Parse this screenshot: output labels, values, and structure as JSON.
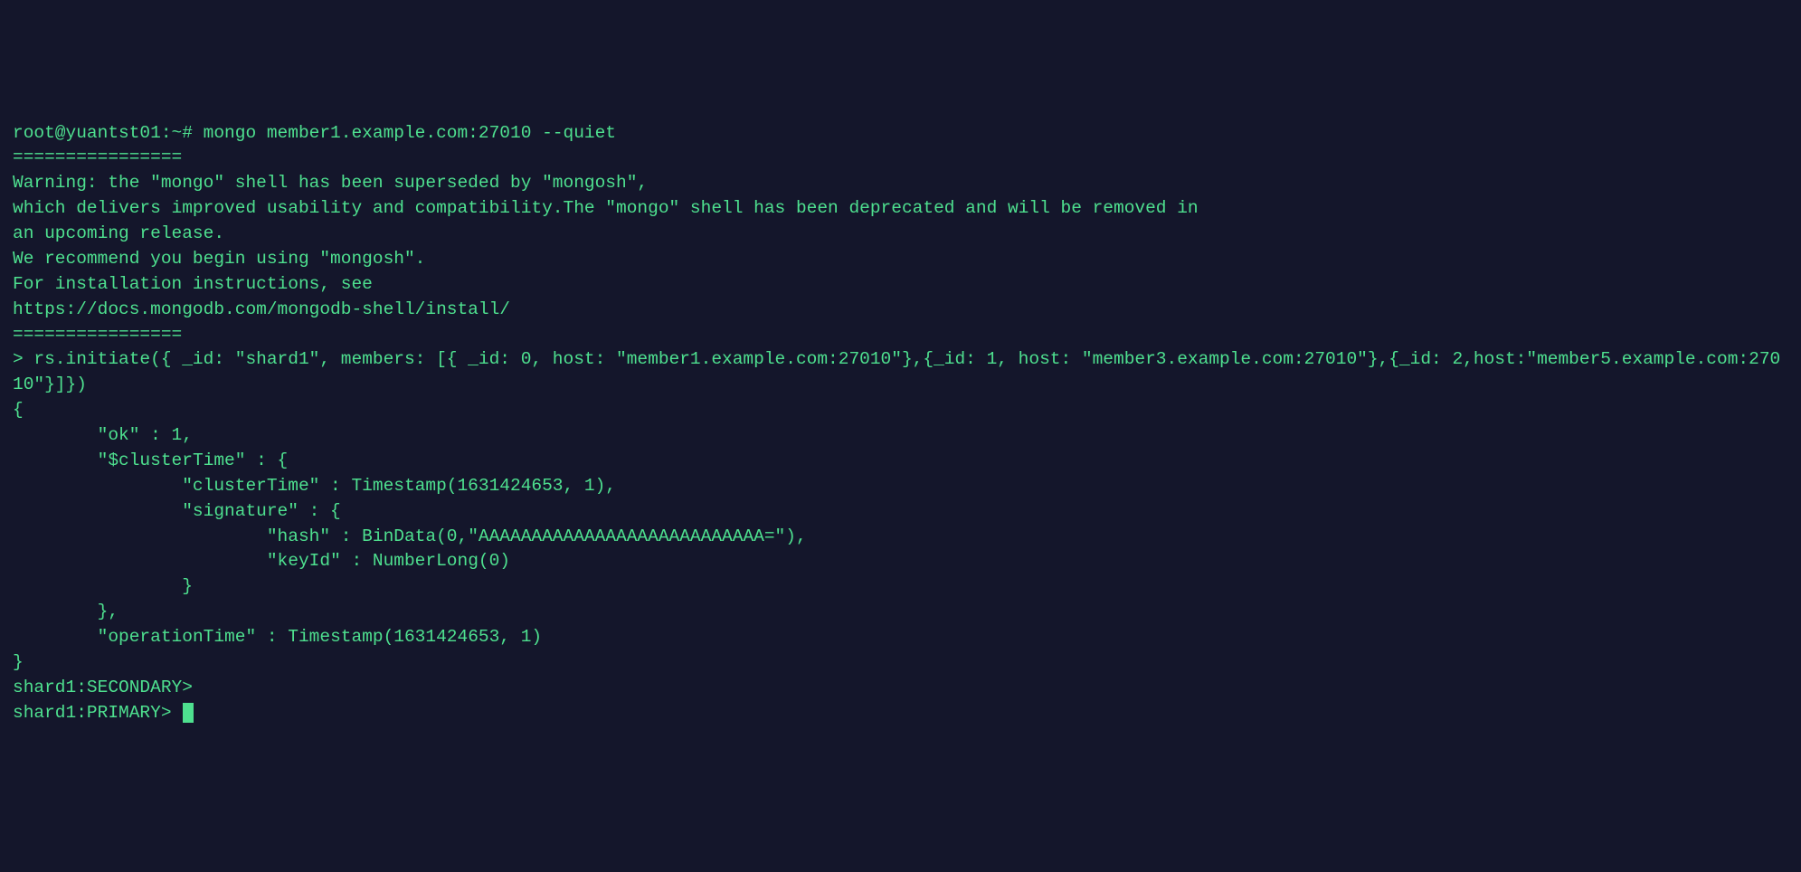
{
  "terminal": {
    "prompt_line": "root@yuantst01:~# mongo member1.example.com:27010 --quiet",
    "separator1": "================",
    "warning_line1": "Warning: the \"mongo\" shell has been superseded by \"mongosh\",",
    "warning_line2": "which delivers improved usability and compatibility.The \"mongo\" shell has been deprecated and will be removed in",
    "warning_line3": "an upcoming release.",
    "warning_line4": "We recommend you begin using \"mongosh\".",
    "warning_line5": "For installation instructions, see",
    "warning_line6": "https://docs.mongodb.com/mongodb-shell/install/",
    "separator2": "================",
    "cmd_line1": "> rs.initiate({ _id: \"shard1\", members: [{ _id: 0, host: \"member1.example.com:27010\"},{_id: 1, host: \"member3.example.com:27010\"},{_id: 2,host:\"member5.example.com:27010\"}]})",
    "resp_open": "{",
    "resp_ok": "        \"ok\" : 1,",
    "resp_cluster_open": "        \"$clusterTime\" : {",
    "resp_cluster_ts": "                \"clusterTime\" : Timestamp(1631424653, 1),",
    "resp_sig_open": "                \"signature\" : {",
    "resp_hash": "                        \"hash\" : BinData(0,\"AAAAAAAAAAAAAAAAAAAAAAAAAAA=\"),",
    "resp_keyid": "                        \"keyId\" : NumberLong(0)",
    "resp_sig_close": "                }",
    "resp_cluster_close": "        },",
    "resp_optime": "        \"operationTime\" : Timestamp(1631424653, 1)",
    "resp_close": "}",
    "prompt_secondary": "shard1:SECONDARY>",
    "prompt_primary": "shard1:PRIMARY> "
  }
}
